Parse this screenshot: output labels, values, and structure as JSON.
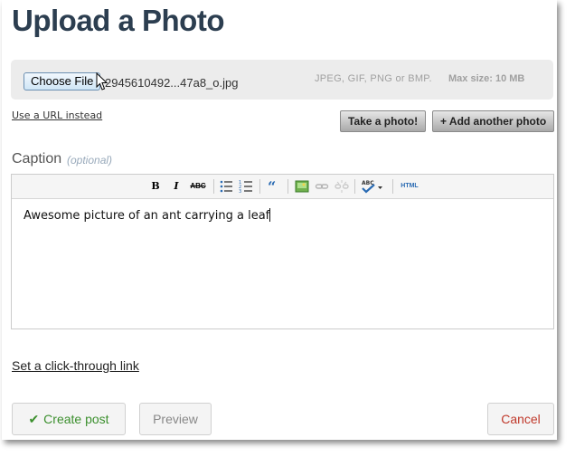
{
  "page": {
    "title": "Upload a Photo"
  },
  "upload": {
    "choose_label": "Choose File",
    "file_name": "2945610492...47a8_o.jpg",
    "formats": "JPEG, GIF, PNG or BMP.",
    "max_size": "Max size: 10 MB"
  },
  "links": {
    "use_url": "Use a URL instead",
    "click_through": "Set a click-through link"
  },
  "actions": {
    "take_photo": "Take a photo!",
    "add_another": "+ Add another photo"
  },
  "caption": {
    "label": "Caption",
    "optional": "(optional)",
    "text": "Awesome picture of an ant carrying a leaf"
  },
  "toolbar": {
    "bold": "B",
    "italic": "I",
    "strike": "ABC",
    "html": "HTML",
    "icons": [
      "bold-icon",
      "italic-icon",
      "strikethrough-icon",
      "bullet-list-icon",
      "numbered-list-icon",
      "blockquote-icon",
      "insert-image-icon",
      "link-icon",
      "unlink-icon",
      "spellcheck-icon",
      "html-icon"
    ]
  },
  "footer": {
    "create_post": "Create post",
    "preview": "Preview",
    "cancel": "Cancel"
  },
  "colors": {
    "title": "#2c3e50",
    "create": "#3b8f2d",
    "cancel": "#c0392b",
    "blockquote": "#2a6bb3"
  }
}
